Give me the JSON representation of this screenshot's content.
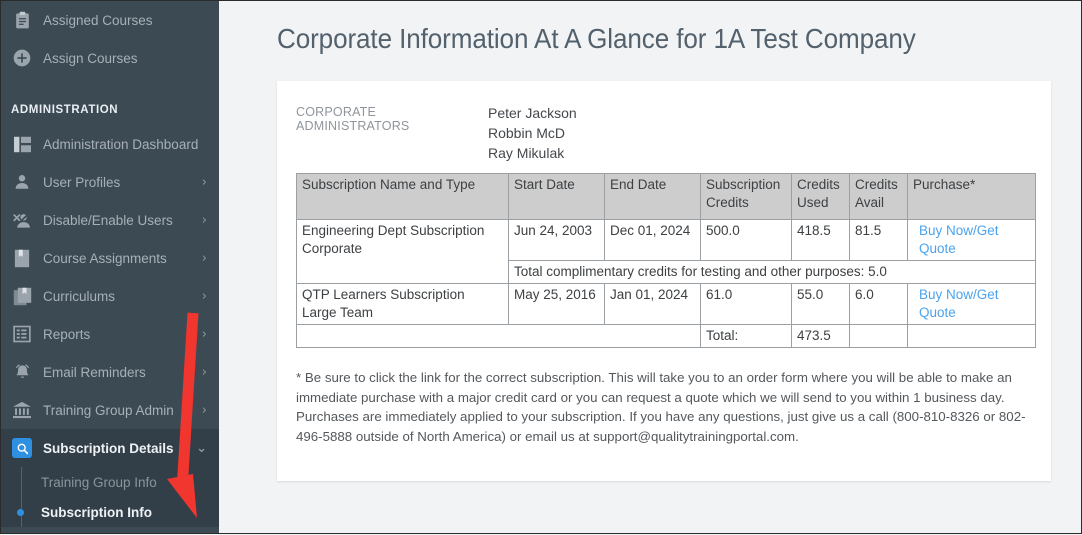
{
  "sidebar": {
    "top_items": [
      {
        "label": "Assigned Courses",
        "icon": "clipboard-icon",
        "chevron": ""
      },
      {
        "label": "Assign Courses",
        "icon": "plus-circle-icon",
        "chevron": ""
      }
    ],
    "section_label": "ADMINISTRATION",
    "admin_items": [
      {
        "label": "Administration Dashboard",
        "icon": "dashboard-icon",
        "chevron": ""
      },
      {
        "label": "User Profiles",
        "icon": "user-icon",
        "chevron": "›"
      },
      {
        "label": "Disable/Enable Users",
        "icon": "user-disable-icon",
        "chevron": "›"
      },
      {
        "label": "Course Assignments",
        "icon": "book-icon",
        "chevron": "›"
      },
      {
        "label": "Curriculums",
        "icon": "books-icon",
        "chevron": "›"
      },
      {
        "label": "Reports",
        "icon": "report-grid-icon",
        "chevron": "›"
      },
      {
        "label": "Email Reminders",
        "icon": "bell-icon",
        "chevron": "›"
      },
      {
        "label": "Training Group Admin",
        "icon": "bank-icon",
        "chevron": "›"
      }
    ],
    "active_group": {
      "label": "Subscription Details",
      "icon": "magnifier-icon",
      "chevron": "⌄",
      "children": [
        {
          "label": "Training Group Info",
          "selected": false
        },
        {
          "label": "Subscription Info",
          "selected": true
        }
      ]
    }
  },
  "main": {
    "page_title": "Corporate Information At A Glance for 1A Test Company",
    "admins_label": "CORPORATE ADMINISTRATORS",
    "admins": [
      "Peter Jackson",
      "Robbin McD",
      "Ray Mikulak"
    ],
    "table": {
      "headers": [
        "Subscription Name and Type",
        "Start Date",
        "End Date",
        "Subscription Credits",
        "Credits Used",
        "Credits Avail",
        "Purchase*"
      ],
      "rows": [
        {
          "name_line1": "Engineering Dept Subscription",
          "name_line2": "Corporate",
          "start": "Jun 24, 2003",
          "end": "Dec 01, 2024",
          "credits": "500.0",
          "used": "418.5",
          "avail": "81.5",
          "purchase": "Buy Now/Get Quote",
          "note": "Total complimentary credits for testing and other purposes: 5.0"
        },
        {
          "name_line1": "QTP Learners Subscription",
          "name_line2": "Large Team",
          "start": "May 25, 2016",
          "end": "Jan 01, 2024",
          "credits": "61.0",
          "used": "55.0",
          "avail": "6.0",
          "purchase": "Buy Now/Get Quote",
          "note": ""
        }
      ],
      "total_label": "Total:",
      "total_value": "473.5"
    },
    "footnote": "* Be sure to click the link for the correct subscription. This will take you to an order form where you will be able to make an immediate purchase with a major credit card or you can request a quote which we will send to you within 1 business day. Purchases are immediately applied to your subscription. If you have any questions, just give us a call (800-810-8326 or 802-496-5888 outside of North America) or email us at support@qualitytrainingportal.com."
  },
  "annotation": {
    "type": "red-arrow",
    "color": "#f1352f",
    "points_to": "Subscription Info"
  },
  "colors": {
    "sidebar_bg": "#3c4a54",
    "sidebar_active_bg": "#333f48",
    "accent_blue": "#2f8fe0",
    "link_blue": "#4aa3ee",
    "page_bg": "#f2f3f5",
    "table_header_bg": "#cdcdcd"
  }
}
